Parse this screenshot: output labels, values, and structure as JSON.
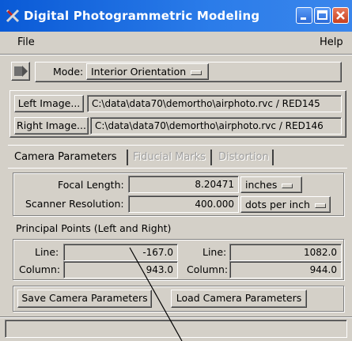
{
  "window": {
    "title": "Digital Photogrammetric Modeling"
  },
  "menubar": {
    "file": "File",
    "help": "Help"
  },
  "mode": {
    "label": "Mode:",
    "value": "Interior Orientation"
  },
  "images": {
    "left_button": "Left Image...",
    "left_path": "C:\\data\\data70\\demortho\\airphoto.rvc / RED145",
    "right_button": "Right Image...",
    "right_path": "C:\\data\\data70\\demortho\\airphoto.rvc / RED146"
  },
  "tabs": [
    {
      "label": "Camera Parameters",
      "state": "active"
    },
    {
      "label": "Fiducial Marks",
      "state": "disabled"
    },
    {
      "label": "Distortion",
      "state": "disabled"
    }
  ],
  "camera": {
    "focal_length_label": "Focal Length:",
    "focal_length_value": "8.20471",
    "focal_length_unit": "inches",
    "scanner_label": "Scanner Resolution:",
    "scanner_value": "400.000",
    "scanner_unit": "dots per inch"
  },
  "principal_points": {
    "title": "Principal Points (Left and Right)",
    "line_label": "Line:",
    "column_label": "Column:",
    "left_line": "-167.0",
    "left_column": "943.0",
    "right_line": "1082.0",
    "right_column": "944.0"
  },
  "actions": {
    "save": "Save Camera Parameters",
    "load": "Load Camera Parameters"
  },
  "status": {
    "text": ""
  }
}
